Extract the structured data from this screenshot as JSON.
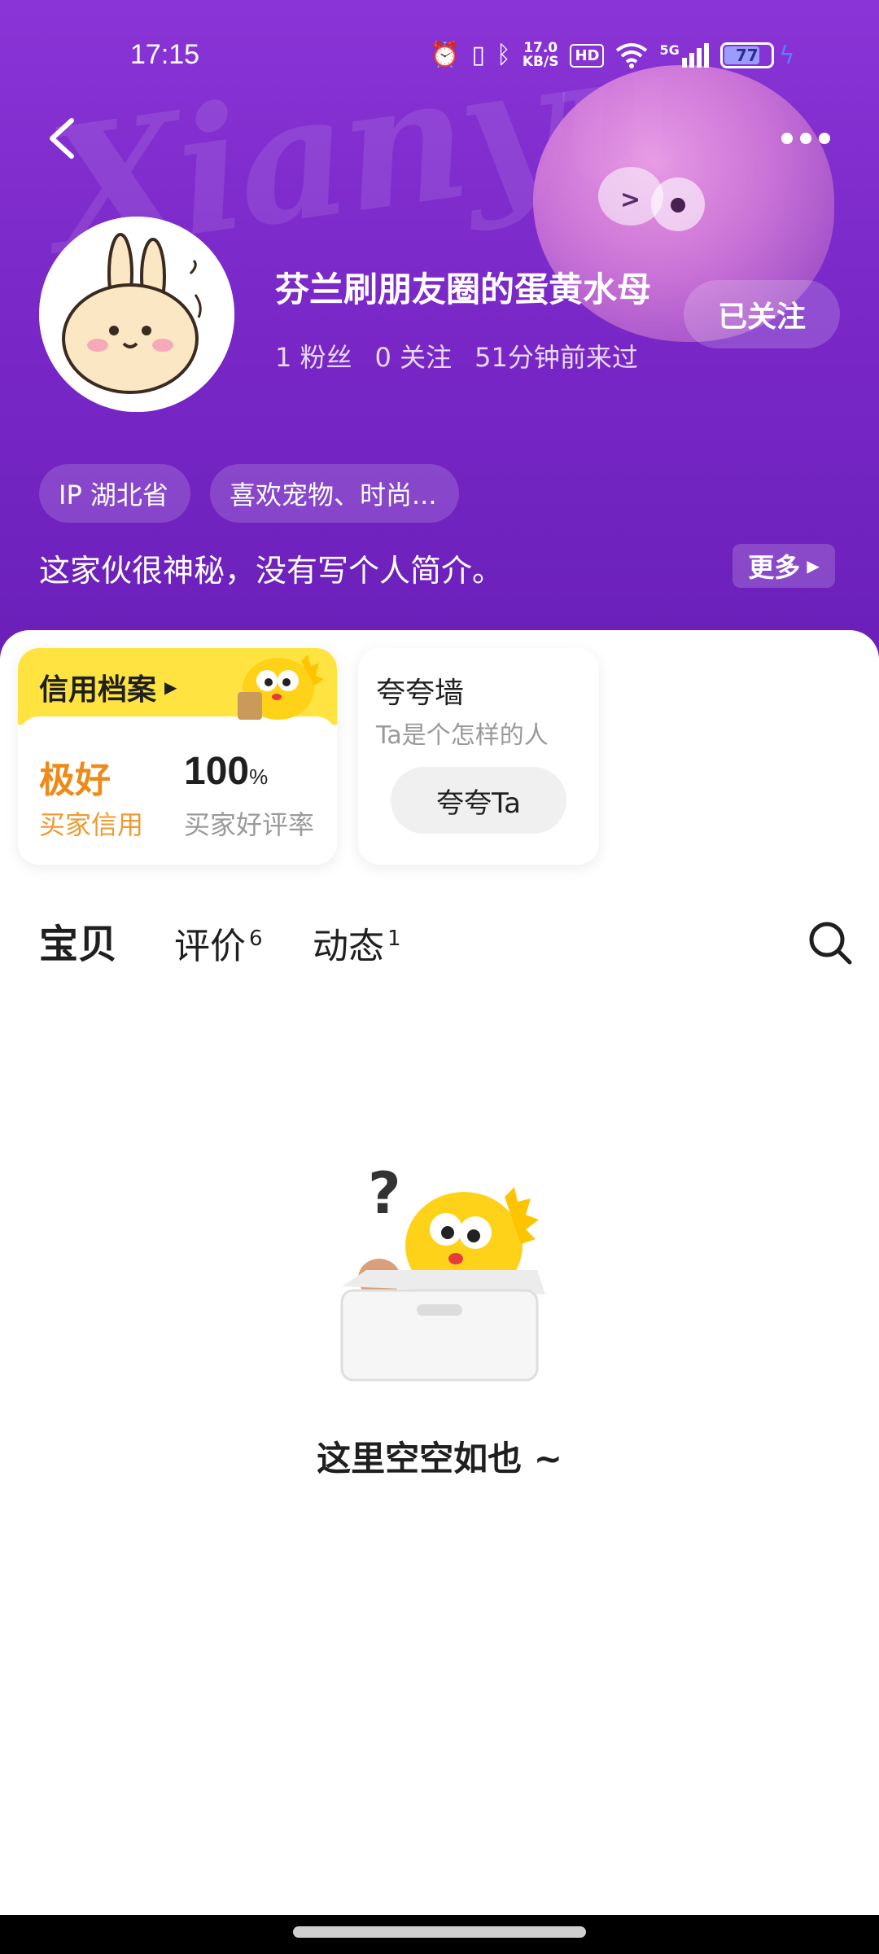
{
  "status_bar": {
    "time": "17:15",
    "net_speed_top": "17.0",
    "net_speed_unit": "KB/S",
    "hd": "HD",
    "signal_5g": "5G",
    "battery": "77",
    "battery_level": 0.77
  },
  "profile": {
    "username": "芬兰刷朋友圈的蛋黄水母",
    "fans": "1 粉丝",
    "following": "0 关注",
    "last_seen": "51分钟前来过",
    "follow_label": "已关注",
    "tags": [
      "IP 湖北省",
      "喜欢宠物、时尚..."
    ],
    "bio": "这家伙很神秘，没有写个人简介。",
    "more_label": "更多"
  },
  "background": {
    "watermark": "Xianyu"
  },
  "credit": {
    "title": "信用档案",
    "level": "极好",
    "level_label": "买家信用",
    "rate": "100",
    "rate_unit": "%",
    "rate_label": "买家好评率"
  },
  "praise": {
    "title": "夸夸墙",
    "subtitle": "Ta是个怎样的人",
    "button": "夸夸Ta"
  },
  "tabs": [
    {
      "label": "宝贝",
      "count": ""
    },
    {
      "label": "评价",
      "count": "6"
    },
    {
      "label": "动态",
      "count": "1"
    }
  ],
  "empty_state": {
    "text": "这里空空如也 ~"
  },
  "colors": {
    "header_purple": "#7a28c8",
    "accent_yellow": "#ffe340",
    "credit_orange": "#ee8a18"
  },
  "icons": {
    "back": "chevron-left-icon",
    "more": "more-dots-icon",
    "search": "search-icon"
  }
}
